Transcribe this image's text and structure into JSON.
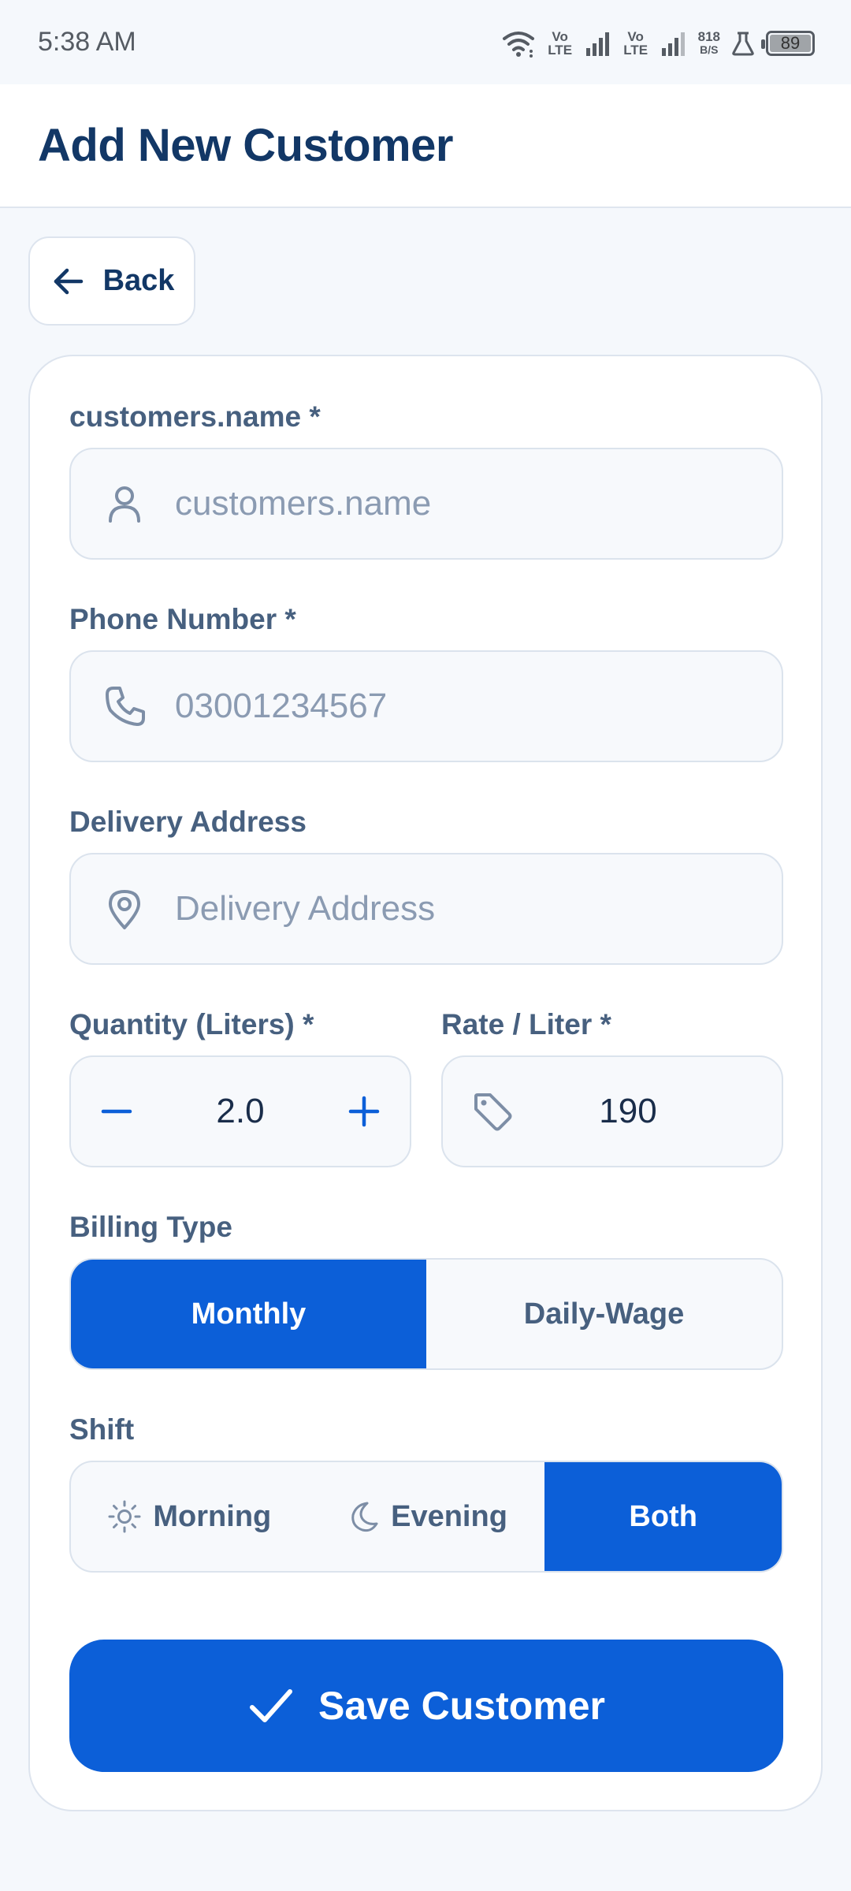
{
  "status_bar": {
    "time": "5:38 AM",
    "volte1": "Vo LTE",
    "volte2": "Vo LTE",
    "net_speed_value": "818",
    "net_speed_unit": "B/S",
    "battery": "89"
  },
  "header": {
    "title": "Add New Customer"
  },
  "back": {
    "label": "Back",
    "icon": "arrow-left-icon"
  },
  "form": {
    "name": {
      "label": "customers.name *",
      "placeholder": "customers.name",
      "icon": "user-icon"
    },
    "phone": {
      "label": "Phone Number *",
      "placeholder": "03001234567",
      "icon": "phone-icon"
    },
    "address": {
      "label": "Delivery Address",
      "placeholder": "Delivery Address",
      "icon": "map-pin-icon"
    },
    "quantity": {
      "label": "Quantity (Liters) *",
      "value": "2.0"
    },
    "rate": {
      "label": "Rate / Liter *",
      "value": "190",
      "icon": "tag-icon"
    },
    "billing": {
      "label": "Billing Type",
      "options": [
        "Monthly",
        "Daily-Wage"
      ],
      "selected": "Monthly"
    },
    "shift": {
      "label": "Shift",
      "options": [
        "Morning",
        "Evening",
        "Both"
      ],
      "selected": "Both"
    },
    "save_label": "Save Customer"
  },
  "colors": {
    "primary": "#0c5fd8",
    "title": "#123766",
    "label": "#47607f",
    "placeholder": "#8b9bb2",
    "background": "#f5f8fc"
  }
}
